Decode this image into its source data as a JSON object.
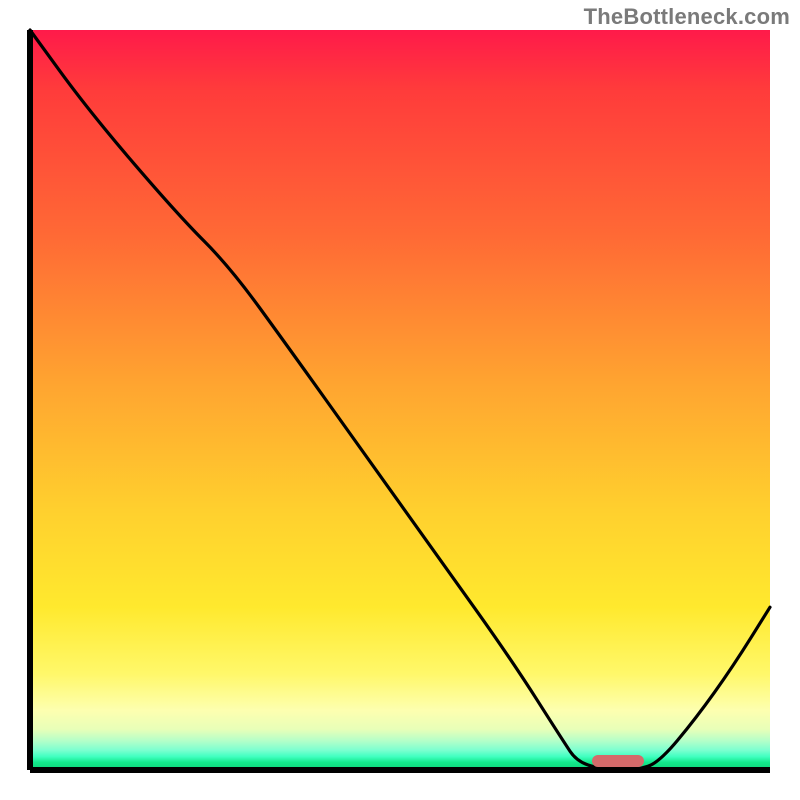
{
  "watermark": "TheBottleneck.com",
  "chart_data": {
    "type": "line",
    "title": "",
    "xlabel": "",
    "ylabel": "",
    "xlim": [
      0,
      100
    ],
    "ylim": [
      0,
      100
    ],
    "series": [
      {
        "name": "bottleneck-curve",
        "x": [
          0,
          8,
          20,
          27,
          35,
          45,
          55,
          65,
          72,
          74,
          78,
          82,
          85,
          90,
          95,
          100
        ],
        "y": [
          100,
          89,
          75,
          68,
          57,
          43,
          29,
          15,
          4,
          1,
          0,
          0,
          1,
          7,
          14,
          22
        ]
      }
    ],
    "marker": {
      "name": "selected-range",
      "x_start": 76,
      "x_end": 83,
      "y": 0,
      "color": "#d46a6a"
    },
    "gradient": {
      "stops": [
        {
          "pos": 0.0,
          "color": "#ff1a4a"
        },
        {
          "pos": 0.28,
          "color": "#ff6a35"
        },
        {
          "pos": 0.65,
          "color": "#ffd02e"
        },
        {
          "pos": 0.92,
          "color": "#fdffb0"
        },
        {
          "pos": 1.0,
          "color": "#0fd47a"
        }
      ]
    },
    "axes": {
      "color": "#000000",
      "thickness": 6
    }
  }
}
